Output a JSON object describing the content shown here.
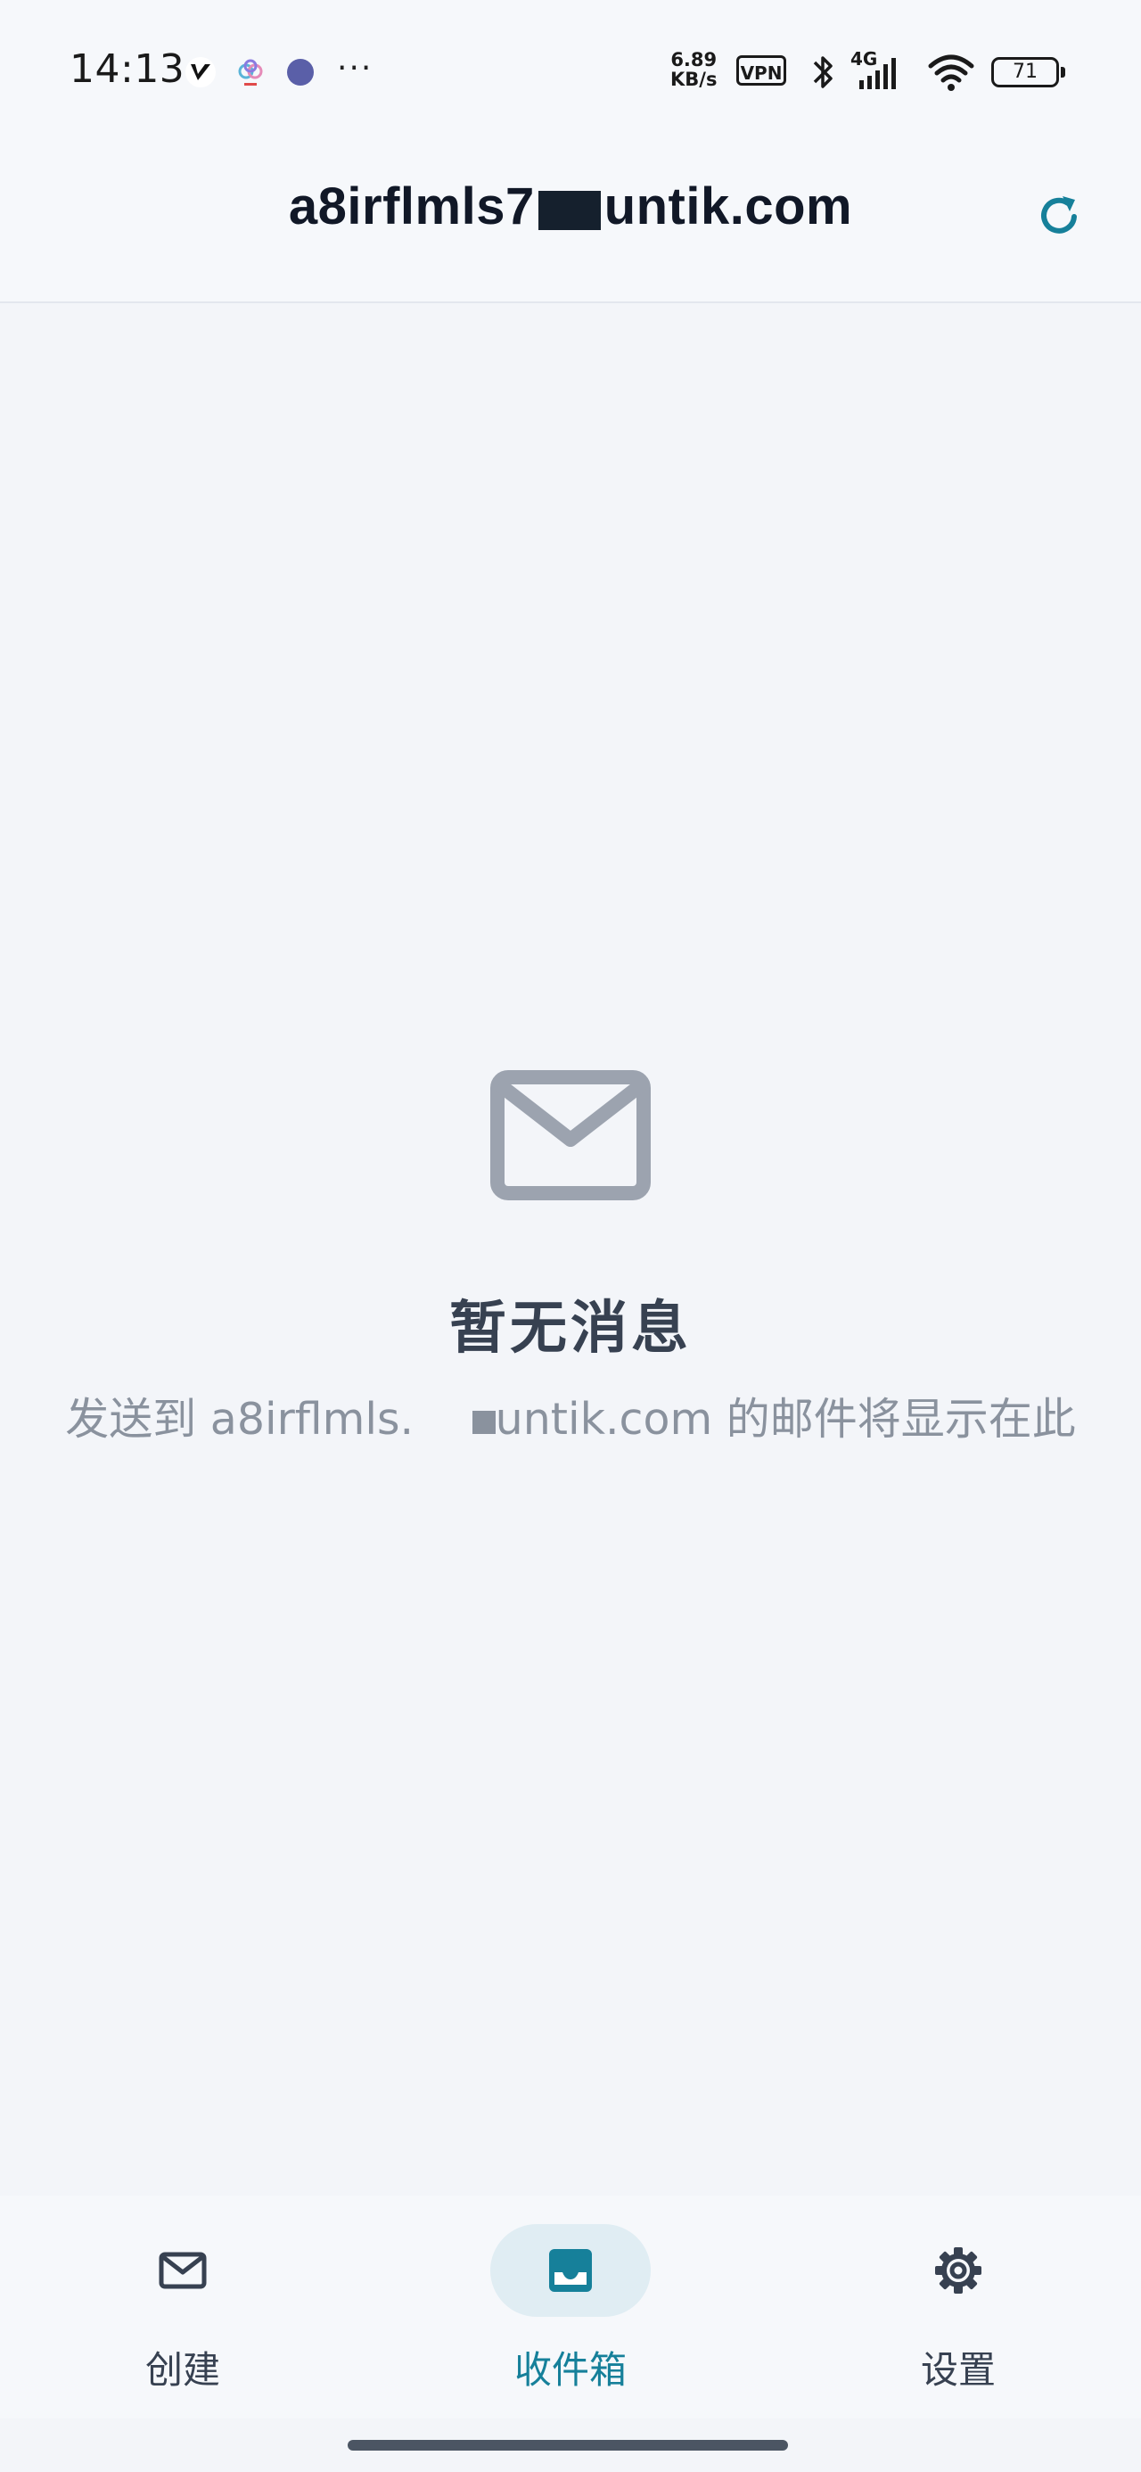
{
  "status_bar": {
    "time": "14:13",
    "more": "···",
    "net_speed_value": "6.89",
    "net_speed_unit": "KB/s",
    "vpn": "VPN",
    "network": "4G",
    "battery": "71"
  },
  "header": {
    "title_prefix": "a8irflmls7",
    "title_suffix": "untik.com"
  },
  "empty_state": {
    "title": "暂无消息",
    "subtitle_prefix": "发送到 a8irflmls.",
    "subtitle_suffix": "untik.com 的邮件将显示在此"
  },
  "bottom_nav": {
    "items": [
      {
        "label": "创建",
        "icon": "mail-icon",
        "active": false
      },
      {
        "label": "收件箱",
        "icon": "inbox-icon",
        "active": true
      },
      {
        "label": "设置",
        "icon": "gear-icon",
        "active": false
      }
    ]
  },
  "colors": {
    "accent": "#16809a",
    "background": "#f3f5f9",
    "active_pill": "#e0edf3",
    "muted_text": "#8a929e",
    "empty_icon": "#9ca3af"
  }
}
